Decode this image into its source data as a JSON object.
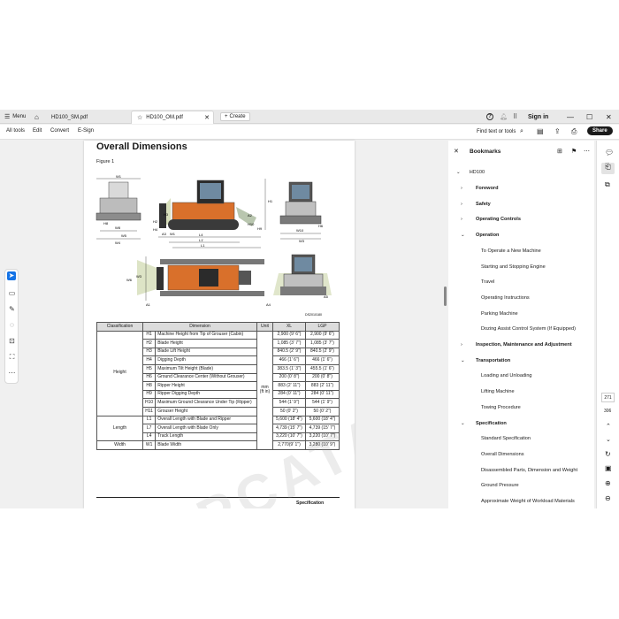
{
  "tabs": {
    "menu_label": "Menu",
    "tab1": "HD100_SM.pdf",
    "tab2": "HD100_OM.pdf",
    "create_label": "Create",
    "help": "?",
    "sign_in": "Sign in"
  },
  "toolbar": {
    "all_tools": "All tools",
    "edit": "Edit",
    "convert": "Convert",
    "esign": "E-Sign",
    "search_label": "Find text or tools",
    "share": "Share"
  },
  "page": {
    "title": "Overall Dimensions",
    "figure": "Figure 1",
    "image_code": "DS2010180",
    "footer": "Specification",
    "labels": {
      "w1": "W1",
      "w2": "W2",
      "w3": "W3",
      "w4": "W4",
      "w5": "W5",
      "w6": "W6",
      "w7": "W7",
      "w8": "W8",
      "w9": "W9",
      "w10": "W10",
      "h1": "H1",
      "h2": "H2",
      "h3": "H3",
      "h4": "H4",
      "h5": "H5",
      "h6": "H6",
      "h8": "H8",
      "h9": "H9",
      "h10": "H10",
      "h11": "H11",
      "a1": "A1",
      "a2": "A2",
      "a3": "A3",
      "a4": "A4",
      "a5": "A5",
      "l1": "L1",
      "l2": "L1'",
      "l4": "L4",
      "l7": "L7"
    },
    "table": {
      "headers": [
        "Classification",
        "Dimension",
        "Unit",
        "XL",
        "LGP"
      ],
      "groups": {
        "height": "Height",
        "length": "Length",
        "width": "Width"
      },
      "unit": "mm (ft in)",
      "rows": [
        {
          "code": "H1",
          "dim": "Machine Height from Tip of Grouser (Cabin)",
          "xl": "2,900 (9' 6\")",
          "lgp": "2,900 (9' 6\")"
        },
        {
          "code": "H2",
          "dim": "Blade Height",
          "xl": "1,085 (3' 7\")",
          "lgp": "1,085 (3' 7\")"
        },
        {
          "code": "H3",
          "dim": "Blade Lift Height",
          "xl": "840.5 (2' 9\")",
          "lgp": "840.5 (2' 9\")"
        },
        {
          "code": "H4",
          "dim": "Digging Depth",
          "xl": "466 (1' 6\")",
          "lgp": "466 (1' 6\")"
        },
        {
          "code": "H5",
          "dim": "Maximum Tilt Height (Blade)",
          "xl": "383.5 (1' 3\")",
          "lgp": "455.5 (1' 6\")"
        },
        {
          "code": "H6",
          "dim": "Ground Clearance Center (Without Grouser)",
          "xl": "200 (0' 8\")",
          "lgp": "200 (0' 8\")"
        },
        {
          "code": "H8",
          "dim": "Ripper Height",
          "xl": "883 (2' 11\")",
          "lgp": "883 (2' 11\")"
        },
        {
          "code": "H9",
          "dim": "Ripper Digging Depth",
          "xl": "284 (0' 11\")",
          "lgp": "284 (0' 11\")"
        },
        {
          "code": "H10",
          "dim": "Maximum Ground Clearance Under Tip (Ripper)",
          "xl": "544 (1' 9\")",
          "lgp": "544 (1' 9\")"
        },
        {
          "code": "H11",
          "dim": "Grouser Height",
          "xl": "50 (0' 2\")",
          "lgp": "50 (0' 2\")"
        },
        {
          "code": "L1",
          "dim": "Overall Length with Blade and Ripper",
          "xl": "5,600 (18' 4\")",
          "lgp": "5,600 (18' 4\")"
        },
        {
          "code": "L7",
          "dim": "Overall Length with Blade Only",
          "xl": "4,739 (15' 7\")",
          "lgp": "4,739 (15' 7\")"
        },
        {
          "code": "L4",
          "dim": "Track Length",
          "xl": "3,220 (10' 7\")",
          "lgp": "3,220 (10' 7\")"
        },
        {
          "code": "W1",
          "dim": "Blade Width",
          "xl": "2,770(9' 1\")",
          "lgp": "3,280 (10' 9\")"
        }
      ]
    }
  },
  "bookmarks": {
    "title": "Bookmarks",
    "root": "HD100",
    "items": [
      {
        "label": "Foreword",
        "level": 1,
        "chev": "›"
      },
      {
        "label": "Safety",
        "level": 1,
        "chev": "›"
      },
      {
        "label": "Operating Controls",
        "level": 1,
        "chev": "›"
      },
      {
        "label": "Operation",
        "level": 1,
        "chev": "⌄"
      },
      {
        "label": "To Operate a New Machine",
        "level": 2
      },
      {
        "label": "Starting and Stopping Engine",
        "level": 2
      },
      {
        "label": "Travel",
        "level": 2
      },
      {
        "label": "Operating Instructions",
        "level": 2
      },
      {
        "label": "Parking Machine",
        "level": 2
      },
      {
        "label": "Dozing Assist Control System (If Equipped)",
        "level": 2
      },
      {
        "label": "Inspection, Maintenance and Adjustment",
        "level": 1,
        "chev": "›"
      },
      {
        "label": "Transportation",
        "level": 1,
        "chev": "⌄"
      },
      {
        "label": "Loading and Unloading",
        "level": 2
      },
      {
        "label": "Lifting Machine",
        "level": 2
      },
      {
        "label": "Towing Procedure",
        "level": 2
      },
      {
        "label": "Specification",
        "level": 1,
        "chev": "⌄"
      },
      {
        "label": "Standard Specification",
        "level": 2
      },
      {
        "label": "Overall Dimensions",
        "level": 2
      },
      {
        "label": "Disassembled Parts, Dimension and Weight",
        "level": 2
      },
      {
        "label": "Ground Pressure",
        "level": 2
      },
      {
        "label": "Approximate Weight of Workload Materials",
        "level": 2
      }
    ]
  },
  "rail": {
    "page_current": "271",
    "page_total": "306"
  },
  "watermark": "EPCATALO.COM",
  "colors": {
    "machine": "#d9702b",
    "share_bg": "#1a1a1a",
    "select_blue": "#1473e6"
  }
}
